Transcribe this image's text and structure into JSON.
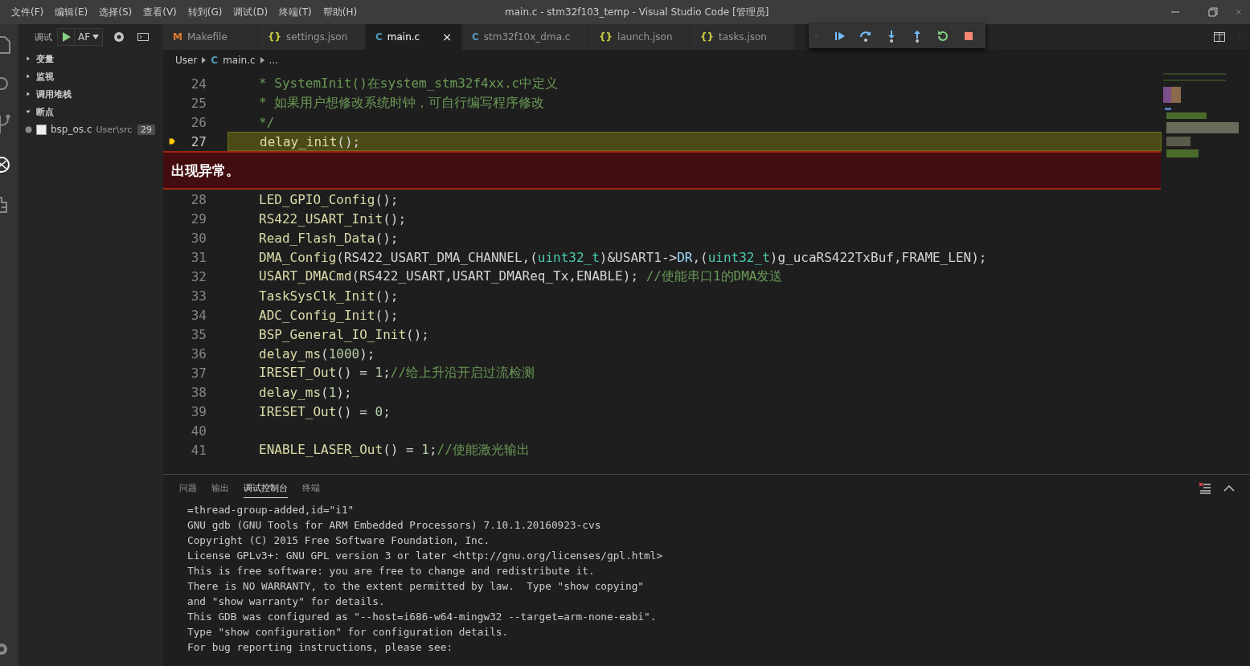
{
  "menu": [
    "文件(F)",
    "编辑(E)",
    "选择(S)",
    "查看(V)",
    "转到(G)",
    "调试(D)",
    "终端(T)",
    "帮助(H)"
  ],
  "window": {
    "title": "main.c - stm32f103_temp - Visual Studio Code [管理员]"
  },
  "sidebar": {
    "title": "调试",
    "config": "AF",
    "sections": [
      {
        "label": "变量",
        "expanded": false
      },
      {
        "label": "监视",
        "expanded": false
      },
      {
        "label": "调用堆栈",
        "expanded": false
      },
      {
        "label": "断点",
        "expanded": true,
        "items": [
          {
            "file": "bsp_os.c",
            "path": "User\\src",
            "line": "29",
            "checked": false
          }
        ]
      }
    ]
  },
  "tabs": [
    {
      "icon": "M",
      "kind": "make",
      "label": "Makefile",
      "selected": false
    },
    {
      "icon": "{}",
      "kind": "json",
      "label": "settings.json",
      "selected": false
    },
    {
      "icon": "C",
      "kind": "c",
      "label": "main.c",
      "selected": true,
      "close": "×"
    },
    {
      "icon": "C",
      "kind": "c",
      "label": "stm32f10x_dma.c",
      "selected": false
    },
    {
      "icon": "{}",
      "kind": "json",
      "label": "launch.json",
      "selected": false
    },
    {
      "icon": "{}",
      "kind": "json",
      "label": "tasks.json",
      "selected": false
    }
  ],
  "breadcrumb": [
    {
      "label": "User"
    },
    {
      "icon": "C",
      "label": "main.c"
    },
    {
      "label": "..."
    }
  ],
  "editor": {
    "exception": "出现异常。",
    "lines": [
      {
        "num": "24",
        "tokens": [
          {
            "text": "* SystemInit()在system_stm32f4xx.c中定义",
            "kind": "comment"
          }
        ]
      },
      {
        "num": "25",
        "tokens": [
          {
            "text": "* 如果用户想修改系统时钟，可自行编写程序修改",
            "kind": "comment"
          }
        ]
      },
      {
        "num": "26",
        "tokens": [
          {
            "text": "*/",
            "kind": "comment"
          }
        ]
      },
      {
        "num": "27",
        "current": true,
        "tokens": [
          {
            "text": "delay_init",
            "kind": "fn"
          },
          {
            "text": "();",
            "kind": "plain"
          }
        ]
      },
      {
        "num": "28",
        "tokens": [
          {
            "text": "LED_GPIO_Config",
            "kind": "fn"
          },
          {
            "text": "();",
            "kind": "plain"
          }
        ]
      },
      {
        "num": "29",
        "tokens": [
          {
            "text": "RS422_USART_Init",
            "kind": "fn"
          },
          {
            "text": "();",
            "kind": "plain"
          }
        ]
      },
      {
        "num": "30",
        "tokens": [
          {
            "text": "Read_Flash_Data",
            "kind": "fn"
          },
          {
            "text": "();",
            "kind": "plain"
          }
        ]
      },
      {
        "num": "31",
        "tokens": [
          {
            "text": "DMA_Config",
            "kind": "fn"
          },
          {
            "text": "(RS422_USART_DMA_CHANNEL,(",
            "kind": "plain"
          },
          {
            "text": "uint32_t",
            "kind": "type"
          },
          {
            "text": ")&USART1->",
            "kind": "plain"
          },
          {
            "text": "DR",
            "kind": "var"
          },
          {
            "text": ",(",
            "kind": "plain"
          },
          {
            "text": "uint32_t",
            "kind": "type"
          },
          {
            "text": ")g_ucaRS422TxBuf,FRAME_LEN);",
            "kind": "plain"
          }
        ]
      },
      {
        "num": "32",
        "tokens": [
          {
            "text": "USART_DMACmd",
            "kind": "fn"
          },
          {
            "text": "(RS422_USART,USART_DMAReq_Tx,ENABLE); ",
            "kind": "plain"
          },
          {
            "text": "//使能串口1的DMA发送",
            "kind": "comment"
          }
        ]
      },
      {
        "num": "33",
        "tokens": [
          {
            "text": "TaskSysClk_Init",
            "kind": "fn"
          },
          {
            "text": "();",
            "kind": "plain"
          }
        ]
      },
      {
        "num": "34",
        "tokens": [
          {
            "text": "ADC_Config_Init",
            "kind": "fn"
          },
          {
            "text": "();",
            "kind": "plain"
          }
        ]
      },
      {
        "num": "35",
        "tokens": [
          {
            "text": "BSP_General_IO_Init",
            "kind": "fn"
          },
          {
            "text": "();",
            "kind": "plain"
          }
        ]
      },
      {
        "num": "36",
        "tokens": [
          {
            "text": "delay_ms",
            "kind": "fn"
          },
          {
            "text": "(",
            "kind": "plain"
          },
          {
            "text": "1000",
            "kind": "num"
          },
          {
            "text": ");",
            "kind": "plain"
          }
        ]
      },
      {
        "num": "37",
        "tokens": [
          {
            "text": "IRESET_Out",
            "kind": "fn"
          },
          {
            "text": "() = ",
            "kind": "plain"
          },
          {
            "text": "1",
            "kind": "num"
          },
          {
            "text": ";",
            "kind": "plain"
          },
          {
            "text": "//给上升沿开启过流检测",
            "kind": "comment"
          }
        ]
      },
      {
        "num": "38",
        "tokens": [
          {
            "text": "delay_ms",
            "kind": "fn"
          },
          {
            "text": "(",
            "kind": "plain"
          },
          {
            "text": "1",
            "kind": "num"
          },
          {
            "text": ");",
            "kind": "plain"
          }
        ]
      },
      {
        "num": "39",
        "tokens": [
          {
            "text": "IRESET_Out",
            "kind": "fn"
          },
          {
            "text": "() = ",
            "kind": "plain"
          },
          {
            "text": "0",
            "kind": "num"
          },
          {
            "text": ";",
            "kind": "plain"
          }
        ]
      },
      {
        "num": "40"
      },
      {
        "num": "41",
        "tokens": [
          {
            "text": "ENABLE_LASER_Out",
            "kind": "fn"
          },
          {
            "text": "() = ",
            "kind": "plain"
          },
          {
            "text": "1",
            "kind": "num"
          },
          {
            "text": ";",
            "kind": "plain"
          },
          {
            "text": "//使能激光输出",
            "kind": "comment"
          }
        ]
      }
    ]
  },
  "panel": {
    "tabs": [
      {
        "label": "问题",
        "selected": false
      },
      {
        "label": "输出",
        "selected": false
      },
      {
        "label": "调试控制台",
        "selected": true
      },
      {
        "label": "终端",
        "selected": false
      }
    ],
    "console": [
      "=thread-group-added,id=\"i1\"",
      "GNU gdb (GNU Tools for ARM Embedded Processors) 7.10.1.20160923-cvs",
      "Copyright (C) 2015 Free Software Foundation, Inc.",
      "License GPLv3+: GNU GPL version 3 or later <http://gnu.org/licenses/gpl.html>",
      "This is free software: you are free to change and redistribute it.",
      "There is NO WARRANTY, to the extent permitted by law.  Type \"show copying\"",
      "and \"show warranty\" for details.",
      "This GDB was configured as \"--host=i686-w64-mingw32 --target=arm-none-eabi\".",
      "Type \"show configuration\" for configuration details.",
      "For bug reporting instructions, please see:"
    ]
  }
}
